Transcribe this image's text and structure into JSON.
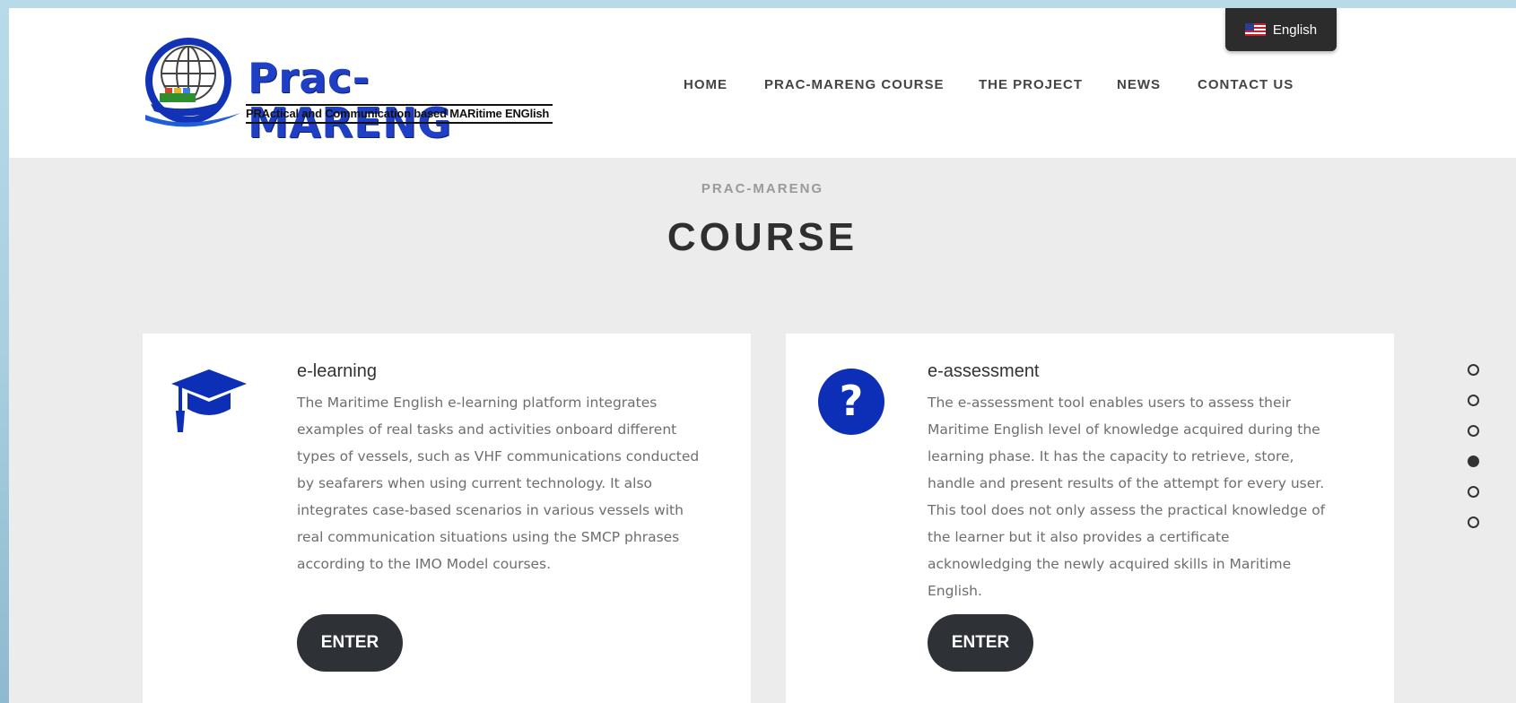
{
  "header": {
    "logo": {
      "name": "Prac-MARENG",
      "tagline": "PRActical and Communication based MARitime ENGlish"
    },
    "language": {
      "label": "English",
      "icon": "us-flag-icon"
    },
    "nav": [
      {
        "label": "HOME"
      },
      {
        "label": "PRAC-MARENG COURSE"
      },
      {
        "label": "THE PROJECT"
      },
      {
        "label": "NEWS"
      },
      {
        "label": "CONTACT US"
      }
    ]
  },
  "section": {
    "label": "PRAC-MARENG",
    "title": "COURSE"
  },
  "cards": [
    {
      "icon": "graduation-cap-icon",
      "title": "e-learning",
      "text": "The Maritime English e-learning platform integrates examples of real tasks and activities onboard different types of vessels, such as VHF communications conducted by seafarers when using current technology. It also integrates case-based scenarios in various vessels with real communication situations using the SMCP phrases according to the IMO Model courses.",
      "button": "ENTER"
    },
    {
      "icon": "question-circle-icon",
      "title": "e-assessment",
      "text": "The e-assessment tool enables users to assess their Maritime English level of knowledge acquired during the learning phase. It has the capacity to retrieve, store, handle and present results of the attempt for every user. This tool does not only assess the practical knowledge of the learner but it also provides a certificate acknowledging the newly acquired skills in Maritime English.",
      "button": "ENTER"
    }
  ],
  "pager": {
    "count": 6,
    "active_index": 3
  },
  "colors": {
    "brand_blue": "#1f3fc7",
    "icon_blue": "#0d2fb7",
    "button_dark": "#2e3236",
    "page_bg": "#ececec"
  }
}
